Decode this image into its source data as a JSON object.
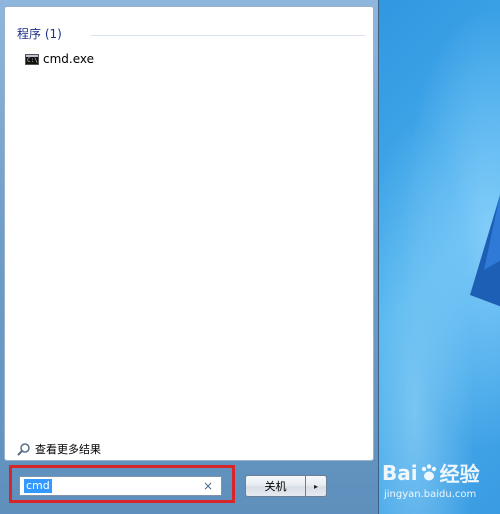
{
  "start_menu": {
    "results_header": "程序 (1)",
    "results": [
      {
        "label": "cmd.exe",
        "icon": "command-prompt-icon"
      }
    ],
    "more_results": "查看更多结果",
    "search": {
      "value": "cmd",
      "clear_symbol": "×"
    },
    "shutdown": {
      "label": "关机",
      "arrow": "▸"
    }
  },
  "desktop": {
    "watermark": {
      "brand_left": "Bai",
      "brand_right": "经验",
      "url": "jingyan.baidu.com"
    }
  },
  "colors": {
    "highlight_border": "#d7262a",
    "selection": "#3399ff",
    "header_text": "#1e3287"
  }
}
